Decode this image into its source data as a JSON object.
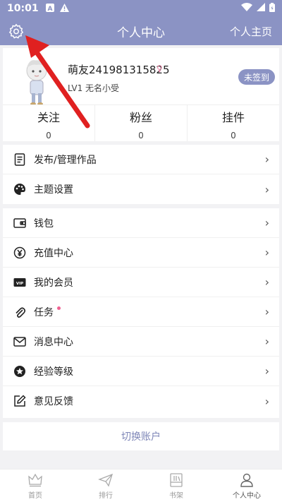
{
  "status_bar": {
    "time": "10:01"
  },
  "header": {
    "title": "个人中心",
    "home_link": "个人主页"
  },
  "profile": {
    "username": "萌友241981315825",
    "gender_symbol": "♀",
    "level": "LV1 无名小受",
    "signin_button": "未签到",
    "stats": [
      {
        "label": "关注",
        "value": "0"
      },
      {
        "label": "粉丝",
        "value": "0"
      },
      {
        "label": "挂件",
        "value": "0"
      }
    ]
  },
  "menu_group1": [
    {
      "label": "发布/管理作品",
      "icon": "document-icon"
    },
    {
      "label": "主题设置",
      "icon": "palette-icon"
    }
  ],
  "menu_group2": [
    {
      "label": "钱包",
      "icon": "wallet-icon"
    },
    {
      "label": "充值中心",
      "icon": "yen-icon"
    },
    {
      "label": "我的会员",
      "icon": "vip-icon"
    },
    {
      "label": "任务",
      "icon": "paperclip-icon",
      "badge_dot": true
    },
    {
      "label": "消息中心",
      "icon": "mail-icon"
    },
    {
      "label": "经验等级",
      "icon": "star-badge-icon"
    },
    {
      "label": "意见反馈",
      "icon": "edit-icon"
    }
  ],
  "switch_account": "切换账户",
  "bottom_nav": [
    {
      "label": "首页",
      "icon": "crown-icon"
    },
    {
      "label": "排行",
      "icon": "paper-plane-icon"
    },
    {
      "label": "书架",
      "icon": "bookshelf-icon"
    },
    {
      "label": "个人中心",
      "icon": "person-icon",
      "active": true
    }
  ],
  "colors": {
    "primary": "#8b93c4",
    "annotation_arrow": "#e02020",
    "badge_dot": "#f06292"
  }
}
